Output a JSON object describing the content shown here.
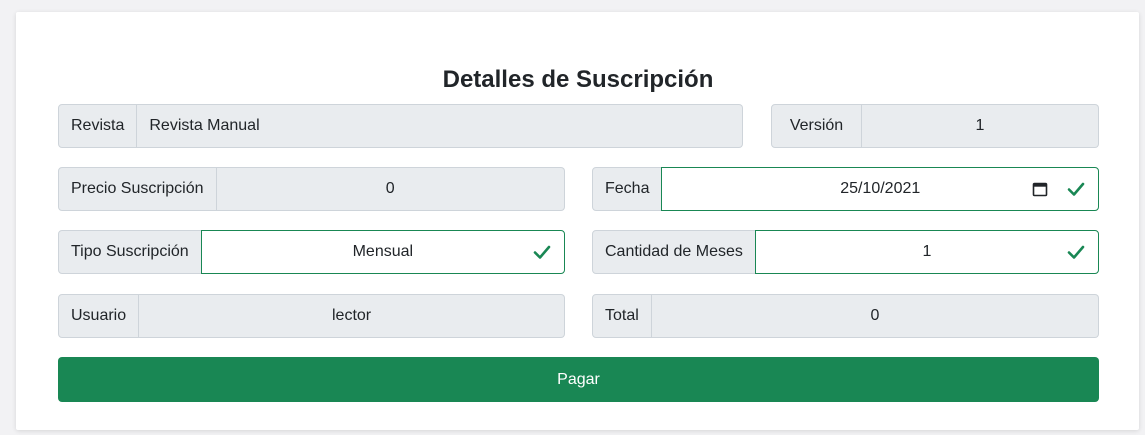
{
  "title": "Detalles de Suscripción",
  "fields": {
    "revista": {
      "label": "Revista",
      "value": "Revista Manual"
    },
    "version": {
      "label": "Versión",
      "value": "1"
    },
    "precio": {
      "label": "Precio Suscripción",
      "value": "0"
    },
    "fecha": {
      "label": "Fecha",
      "value": "25/10/2021"
    },
    "tipo": {
      "label": "Tipo Suscripción",
      "value": "Mensual"
    },
    "meses": {
      "label": "Cantidad de Meses",
      "value": "1"
    },
    "usuario": {
      "label": "Usuario",
      "value": "lector"
    },
    "total": {
      "label": "Total",
      "value": "0"
    }
  },
  "pay_button": {
    "label": "Pagar"
  },
  "icons": {
    "valid": "check-icon",
    "date": "calendar-icon"
  },
  "colors": {
    "success": "#198754",
    "addon_bg": "#e9ecef",
    "border": "#ced4da"
  }
}
